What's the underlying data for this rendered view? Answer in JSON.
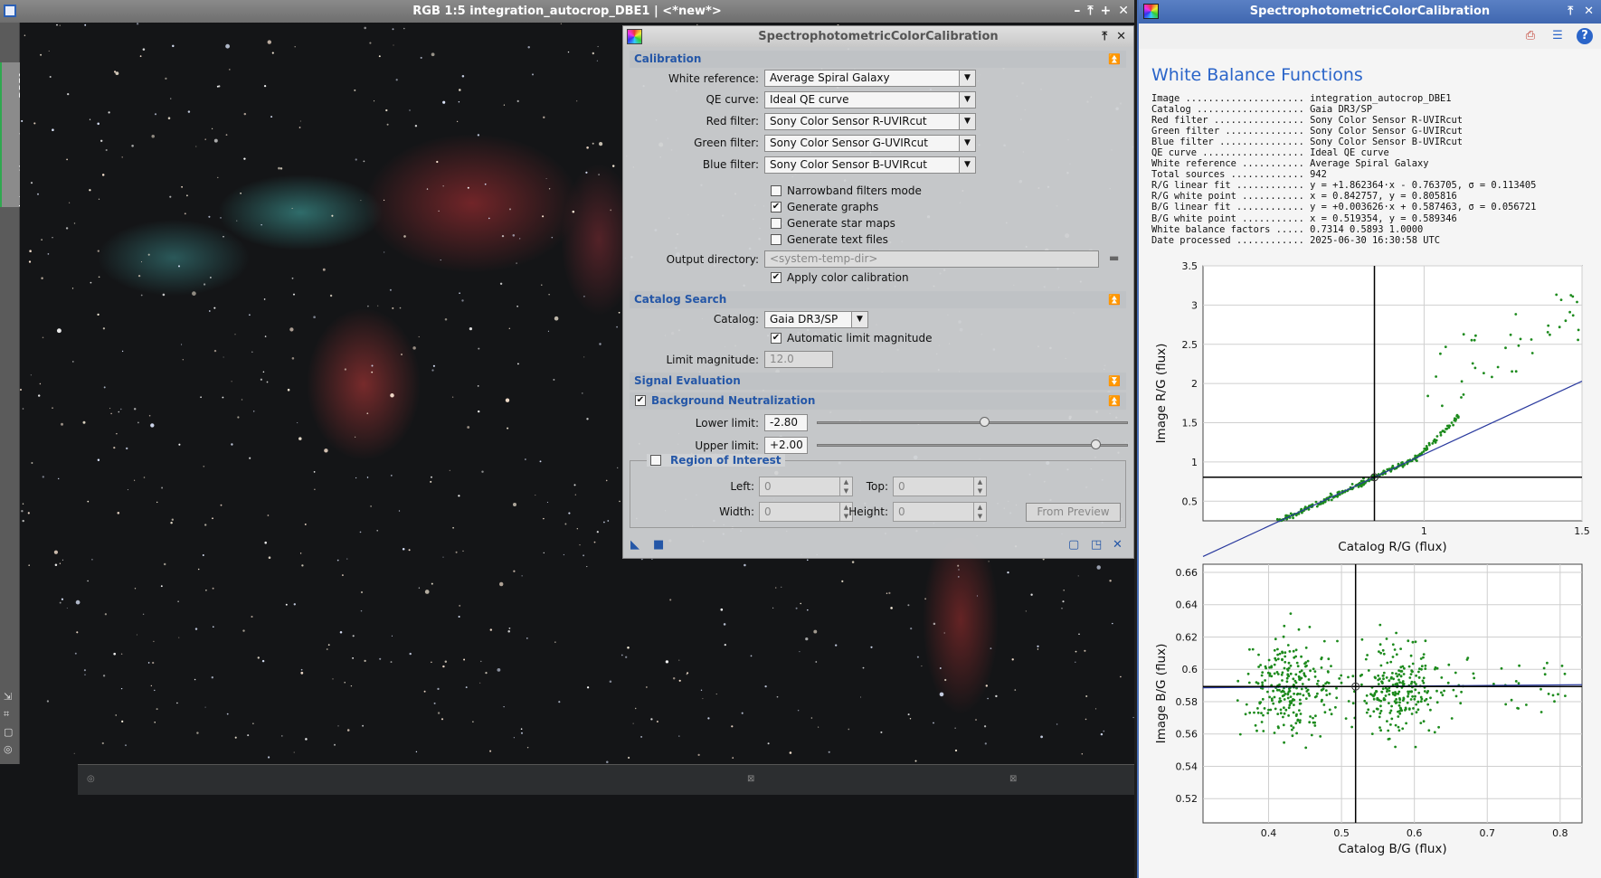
{
  "image_window": {
    "title": "RGB 1:5 integration_autocrop_DBE1 | <*new*>",
    "view_tab_label": "integration_autocrop_DBE1",
    "controls": [
      "–",
      "⤒",
      "+",
      "✕"
    ]
  },
  "spcc_dialog": {
    "title": "SpectrophotometricColorCalibration",
    "controls": [
      "⤒",
      "✕"
    ],
    "calibration": {
      "section_label": "Calibration",
      "white_reference_label": "White reference:",
      "white_reference_value": "Average Spiral Galaxy",
      "qe_curve_label": "QE curve:",
      "qe_curve_value": "Ideal QE curve",
      "red_filter_label": "Red filter:",
      "red_filter_value": "Sony Color Sensor R-UVIRcut",
      "green_filter_label": "Green filter:",
      "green_filter_value": "Sony Color Sensor G-UVIRcut",
      "blue_filter_label": "Blue filter:",
      "blue_filter_value": "Sony Color Sensor B-UVIRcut",
      "narrowband_label": "Narrowband filters mode",
      "narrowband_checked": false,
      "generate_graphs_label": "Generate graphs",
      "generate_graphs_checked": true,
      "generate_star_maps_label": "Generate star maps",
      "generate_star_maps_checked": false,
      "generate_text_files_label": "Generate text files",
      "generate_text_files_checked": false,
      "output_directory_label": "Output directory:",
      "output_directory_placeholder": "<system-temp-dir>",
      "apply_color_calibration_label": "Apply color calibration",
      "apply_color_calibration_checked": true
    },
    "catalog_search": {
      "section_label": "Catalog Search",
      "catalog_label": "Catalog:",
      "catalog_value": "Gaia DR3/SP",
      "auto_limit_label": "Automatic limit magnitude",
      "auto_limit_checked": true,
      "limit_magnitude_label": "Limit magnitude:",
      "limit_magnitude_value": "12.0"
    },
    "signal_evaluation": {
      "section_label": "Signal Evaluation"
    },
    "background_neutralization": {
      "section_label": "Background Neutralization",
      "enabled": true,
      "lower_limit_label": "Lower limit:",
      "lower_limit_value": "-2.80",
      "lower_limit_fraction": 0.54,
      "upper_limit_label": "Upper limit:",
      "upper_limit_value": "+2.00",
      "upper_limit_fraction": 0.9,
      "roi": {
        "label": "Region of Interest",
        "checked": false,
        "left_label": "Left:",
        "left_value": "0",
        "top_label": "Top:",
        "top_value": "0",
        "width_label": "Width:",
        "width_value": "0",
        "height_label": "Height:",
        "height_value": "0",
        "from_preview_label": "From Preview"
      }
    }
  },
  "results_panel": {
    "title": "SpectrophotometricColorCalibration",
    "controls": [
      "⤒",
      "✕"
    ],
    "heading": "White Balance Functions",
    "report_lines": [
      "Image ..................... integration_autocrop_DBE1",
      "Catalog ................... Gaia DR3/SP",
      "Red filter ................ Sony Color Sensor R-UVIRcut",
      "Green filter .............. Sony Color Sensor G-UVIRcut",
      "Blue filter ............... Sony Color Sensor B-UVIRcut",
      "QE curve .................. Ideal QE curve",
      "White reference ........... Average Spiral Galaxy",
      "Total sources ............. 942",
      "R/G linear fit ............ y = +1.862364·x - 0.763705, σ = 0.113405",
      "R/G white point ........... x = 0.842757, y = 0.805816",
      "B/G linear fit ............ y = +0.003626·x + 0.587463, σ = 0.056721",
      "B/G white point ........... x = 0.519354, y = 0.589346",
      "White balance factors ..... 0.7314 0.5893 1.0000",
      "Date processed ............ 2025-06-30 16:30:58 UTC"
    ]
  },
  "chart_data": [
    {
      "type": "scatter",
      "xlabel": "Catalog R/G (flux)",
      "ylabel": "Image R/G (flux)",
      "xlim": [
        0.3,
        1.5
      ],
      "ylim": [
        0.25,
        3.5
      ],
      "x_ticks": [
        "1",
        "1.5"
      ],
      "y_ticks": [
        "0.5",
        "1",
        "1.5",
        "2",
        "2.5",
        "3",
        "3.5"
      ],
      "grid": true,
      "fit_line": {
        "slope": 1.862364,
        "intercept": -0.763705,
        "color": "#2a3a9e"
      },
      "white_point": {
        "x": 0.842757,
        "y": 0.805816
      },
      "point_color": "#1c8a1c",
      "n_points": 942
    },
    {
      "type": "scatter",
      "xlabel": "Catalog B/G (flux)",
      "ylabel": "Image B/G (flux)",
      "xlim": [
        0.31,
        0.83
      ],
      "ylim": [
        0.505,
        0.665
      ],
      "x_ticks": [
        "0.4",
        "0.5",
        "0.6",
        "0.7",
        "0.8"
      ],
      "y_ticks": [
        "0.52",
        "0.54",
        "0.56",
        "0.58",
        "0.6",
        "0.62",
        "0.64",
        "0.66"
      ],
      "grid": true,
      "fit_line": {
        "slope": 0.003626,
        "intercept": 0.587463,
        "color": "#2a3a9e"
      },
      "white_point": {
        "x": 0.519354,
        "y": 0.589346
      },
      "point_color": "#1c8a1c",
      "n_points": 942
    }
  ]
}
